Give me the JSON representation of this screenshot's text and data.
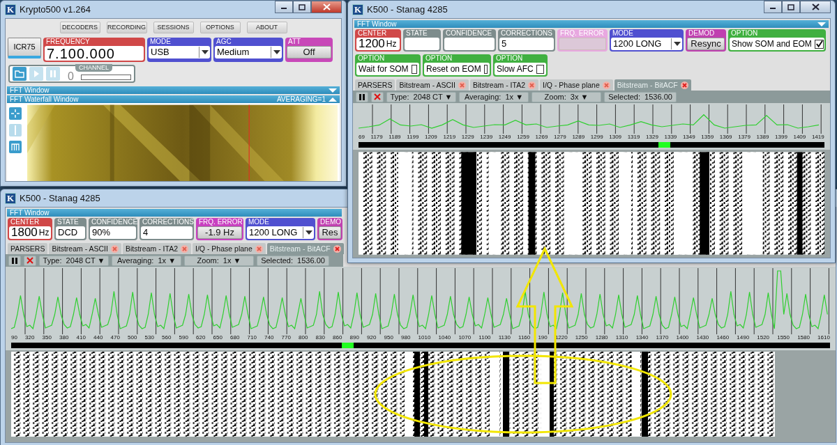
{
  "main_window": {
    "logo": "K",
    "title": "Krypto500 v1.264",
    "controls": true,
    "active": true,
    "menu": [
      "DECODERS",
      "RECORDING",
      "SESSIONS",
      "OPTIONS",
      "ABOUT"
    ],
    "radio_button": {
      "label": "ICR75",
      "selected": true
    },
    "fields": [
      {
        "label": "FREQUENCY",
        "kind": "big",
        "value": "7.100.000",
        "color": "#d04848"
      },
      {
        "label": "MODE",
        "kind": "select",
        "value": "USB",
        "color": "#5050d0"
      },
      {
        "label": "AGC",
        "kind": "select",
        "value": "Medium",
        "color": "#5050d0"
      },
      {
        "label": "ATT",
        "kind": "button",
        "value": "Off",
        "color": "#c848b8"
      }
    ],
    "transport": [
      {
        "kind": "open",
        "disabled": false
      },
      {
        "kind": "play",
        "disabled": true
      },
      {
        "kind": "pause",
        "disabled": true
      }
    ],
    "channel": {
      "label": "CHANNEL",
      "value": "0"
    },
    "fft_bar": "FFT Window",
    "waterfall": {
      "title": "FFT Waterfall Window",
      "averaging": "AVERAGING=1"
    }
  },
  "back_window": {
    "logo": "K",
    "title": "K500 - Stanag 4285",
    "controls": false,
    "fft_bar": "FFT Window",
    "fields": [
      {
        "label": "CENTER",
        "kind": "unit",
        "value": "1800",
        "unit": "Hz",
        "color": "#d04848",
        "disabled": false
      },
      {
        "label": "STATE",
        "kind": "value",
        "value": "DCD",
        "color": "#7d8c8c",
        "disabled": false
      },
      {
        "label": "CONFIDENCE",
        "kind": "value",
        "value": "90%",
        "color": "#7d8c8c",
        "disabled": false
      },
      {
        "label": "CORRECTIONS",
        "kind": "value",
        "value": "4",
        "color": "#7d8c8c",
        "disabled": false
      },
      {
        "label": "FRQ. ERROR",
        "kind": "button",
        "value": "-1.9 Hz",
        "color": "#c840c0",
        "disabled": false
      },
      {
        "label": "MODE",
        "kind": "select",
        "value": "1200 LONG",
        "color": "#5050d0",
        "disabled": false
      },
      {
        "label": "DEMO",
        "kind": "button",
        "value": "Res",
        "color": "#c040b0",
        "disabled": false
      }
    ],
    "parsers_label": "PARSERS",
    "tabs": [
      {
        "label": "Bitstream - ASCII",
        "selected": false
      },
      {
        "label": "Bitstream - ITA2",
        "selected": false
      },
      {
        "label": "I/Q - Phase plane",
        "selected": false
      },
      {
        "label": "Bitstream - BitACF",
        "selected": true
      }
    ],
    "toolbar": {
      "type": "Type:  2048 CT ▼",
      "averaging": "Averaging:  1x ▼",
      "zoom": "Zoom:  1x ▼",
      "selected": "Selected:  1536.00"
    },
    "axis_labels": [
      "90",
      "320",
      "350",
      "380",
      "410",
      "440",
      "470",
      "500",
      "530",
      "560",
      "590",
      "620",
      "650",
      "680",
      "710",
      "740",
      "770",
      "800",
      "830",
      "860",
      "890",
      "920",
      "950",
      "980",
      "1010",
      "1040",
      "1070",
      "1100",
      "1130",
      "1160",
      "190",
      "1220",
      "1250",
      "1280",
      "1310",
      "1340",
      "1370",
      "1400",
      "1430",
      "1460",
      "1490",
      "1520",
      "1550",
      "1580",
      "1610"
    ]
  },
  "front_window": {
    "logo": "K",
    "title": "K500 - Stanag 4285",
    "controls": true,
    "active": false,
    "fft_bar": "FFT Window",
    "fields": [
      {
        "label": "CENTER",
        "kind": "unit",
        "value": "1200",
        "unit": "Hz",
        "color": "#d04848",
        "disabled": false
      },
      {
        "label": "STATE",
        "kind": "value",
        "color": "#7d8c8c",
        "disabled": false
      },
      {
        "label": "CONFIDENCE",
        "kind": "value",
        "color": "#7d8c8c",
        "disabled": false
      },
      {
        "label": "CORRECTIONS",
        "kind": "value",
        "value": "5",
        "color": "#7d8c8c",
        "disabled": false
      },
      {
        "label": "FRQ. ERROR",
        "kind": "button",
        "color": "#e8a8e0",
        "disabled": true
      },
      {
        "label": "MODE",
        "kind": "select",
        "value": "1200 LONG",
        "color": "#5050d0",
        "disabled": false
      },
      {
        "label": "DEMOD",
        "kind": "button",
        "value": "Resync",
        "color": "#c040b0",
        "disabled": false
      },
      {
        "label": "OPTION",
        "kind": "check",
        "value": "Show SOM and EOM",
        "checked": true,
        "color": "#40b040",
        "disabled": false
      }
    ],
    "options": [
      {
        "label": "OPTION",
        "kind": "check",
        "value": "Wait for SOM",
        "checked": false,
        "color": "#40b040",
        "disabled": false
      },
      {
        "label": "OPTION",
        "kind": "check",
        "value": "Reset on EOM",
        "checked": false,
        "color": "#40b040",
        "disabled": false
      },
      {
        "label": "OPTION",
        "kind": "check",
        "value": "Slow AFC",
        "checked": false,
        "color": "#40b040",
        "disabled": false
      }
    ],
    "parsers_label": "PARSERS",
    "tabs": [
      {
        "label": "Bitstream - ASCII",
        "selected": false
      },
      {
        "label": "Bitstream - ITA2",
        "selected": false
      },
      {
        "label": "I/Q - Phase plane",
        "selected": false
      },
      {
        "label": "Bitstream - BitACF",
        "selected": true
      }
    ],
    "toolbar": {
      "type": "Type:  2048 CT ▼",
      "averaging": "Averaging:  1x ▼",
      "zoom": "Zoom:  3x ▼",
      "selected": "Selected:  1536.00"
    },
    "axis_labels": [
      "69",
      "1179",
      "1189",
      "1199",
      "1209",
      "1219",
      "1229",
      "1239",
      "1249",
      "1259",
      "1269",
      "1279",
      "1289",
      "1299",
      "1309",
      "1319",
      "1329",
      "1339",
      "1349",
      "1359",
      "1369",
      "1379",
      "1389",
      "1399",
      "1409",
      "1419"
    ]
  }
}
